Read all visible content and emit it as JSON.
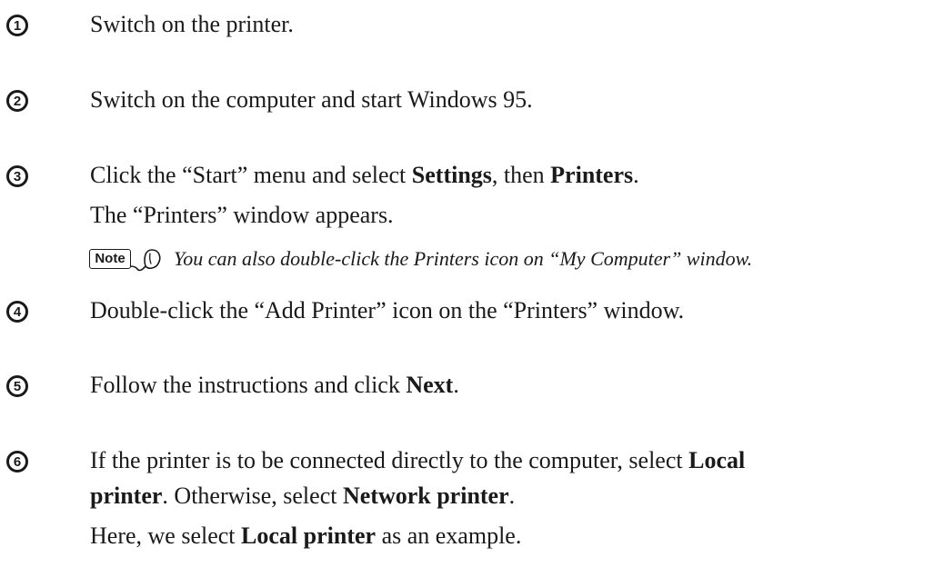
{
  "steps": [
    {
      "num": "1",
      "lines": [
        [
          "Switch on the printer."
        ]
      ]
    },
    {
      "num": "2",
      "lines": [
        [
          "Switch on the computer and start Windows 95."
        ]
      ]
    },
    {
      "num": "3",
      "lines": [
        [
          "Click the “Start” menu and select ",
          "Settings",
          ", then ",
          "Printers",
          "."
        ],
        [
          "The “Printers” window appears."
        ]
      ],
      "note": {
        "badge": "Note",
        "text": "You can also double-click the Printers icon on “My Computer” window."
      }
    },
    {
      "num": "4",
      "lines": [
        [
          "Double-click the “Add Printer” icon on the “Printers” window."
        ]
      ]
    },
    {
      "num": "5",
      "lines": [
        [
          "Follow the instructions and click ",
          "Next",
          "."
        ]
      ]
    },
    {
      "num": "6",
      "lines": [
        [
          "If the printer is to be connected directly to the computer, select ",
          "Local"
        ],
        [
          "printer",
          ". Otherwise, select ",
          "Network printer",
          "."
        ],
        [
          "Here, we select ",
          "Local printer",
          " as an example."
        ]
      ]
    }
  ]
}
